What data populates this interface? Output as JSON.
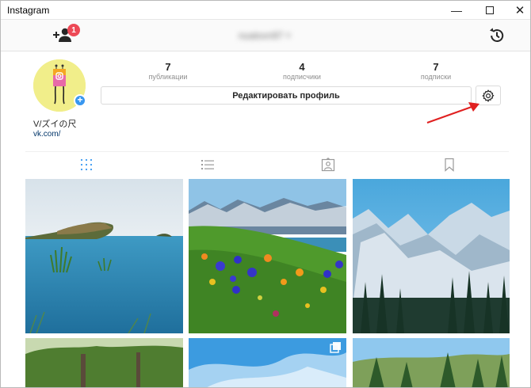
{
  "window": {
    "title": "Instagram",
    "minimize_glyph": "—",
    "close_glyph": "✕"
  },
  "header": {
    "notification_count": "1",
    "username": "nuatovn97 ˅",
    "icons": [
      "add-person-icon",
      "history-icon"
    ]
  },
  "profile": {
    "stats": [
      {
        "value": "7",
        "label": "публикации"
      },
      {
        "value": "4",
        "label": "подписчики"
      },
      {
        "value": "7",
        "label": "подписки"
      }
    ],
    "edit_button_label": "Редактировать профиль",
    "name": "V/ズイの尺",
    "link": "vk.com/"
  },
  "tabs": [
    "grid-icon",
    "list-icon",
    "tagged-icon",
    "bookmark-icon"
  ],
  "colors": {
    "accent": "#3897f0",
    "badge": "#ed4956",
    "arrow": "#e02020",
    "link": "#003569"
  }
}
